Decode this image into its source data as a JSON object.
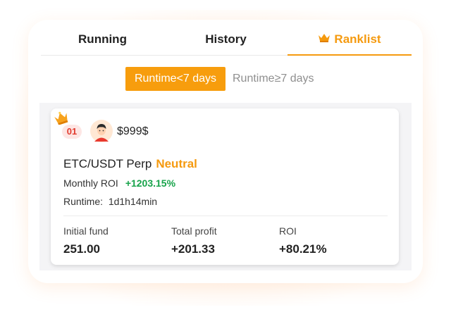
{
  "tabs": [
    {
      "label": "Running"
    },
    {
      "label": "History"
    },
    {
      "label": "Ranklist",
      "icon": "crown-icon",
      "active": true
    }
  ],
  "period_filter": {
    "options": [
      "Runtime<7 days",
      "Runtime≥7 days"
    ],
    "selected": "Runtime<7 days"
  },
  "ranking_card": {
    "rank": "01",
    "username": "$999$",
    "pair": "ETC/USDT Perp",
    "mode": "Neutral",
    "monthly_roi_label": "Monthly ROI",
    "monthly_roi_value": "+1203.15%",
    "runtime_label": "Runtime:",
    "runtime_value": "1d1h14min",
    "stats": [
      {
        "label": "Initial fund",
        "value": "251.00"
      },
      {
        "label": "Total profit",
        "value": "+201.33"
      },
      {
        "label": "ROI",
        "value": "+80.21%"
      }
    ]
  },
  "colors": {
    "accent": "#f59a0f",
    "positive": "#17a34a",
    "rank_badge": "#e23b2e"
  }
}
